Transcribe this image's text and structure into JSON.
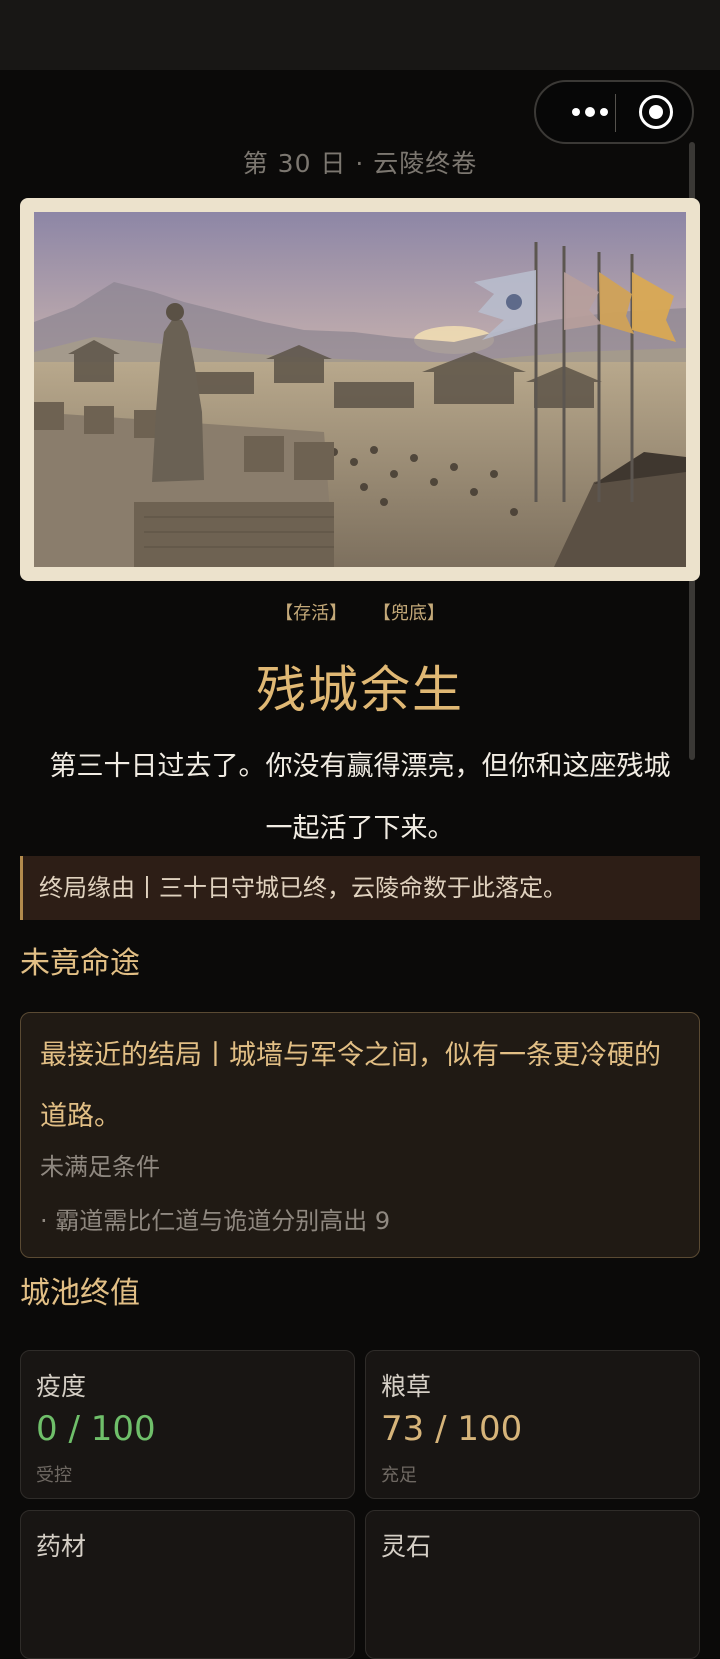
{
  "header": {
    "more_icon": "more-dots-icon",
    "close_icon": "record-target-icon"
  },
  "page": {
    "subtitle": "第 30 日 · 云陵终卷",
    "tags": [
      "【存活】",
      "【兜底】"
    ],
    "title": "残城余生",
    "body": "第三十日过去了。你没有赢得漂亮，但你和这座残城一起活了下来。",
    "reason": "终局缘由丨三十日守城已终，云陵命数于此落定。"
  },
  "unfinished": {
    "heading": "未竟命途",
    "closest_ending": "最接近的结局丨城墙与军令之间，似有一条更冷硬的道路。",
    "condition_label": "未满足条件",
    "requirements": [
      "· 霸道需比仁道与诡道分别高出 9"
    ]
  },
  "final_values": {
    "heading": "城池终值",
    "stats": [
      {
        "name": "疫度",
        "value": "0 / 100",
        "note": "受控",
        "color": "#6fbf6a"
      },
      {
        "name": "粮草",
        "value": "73 / 100",
        "note": "充足",
        "color": "#d6b47a"
      },
      {
        "name": "药材",
        "value": "",
        "note": "",
        "color": "#d6b47a"
      },
      {
        "name": "灵石",
        "value": "",
        "note": "",
        "color": "#d6b47a"
      }
    ]
  },
  "colors": {
    "accent_gold": "#e2bf85",
    "good_green": "#6fbf6a",
    "background": "#0b0a09"
  }
}
